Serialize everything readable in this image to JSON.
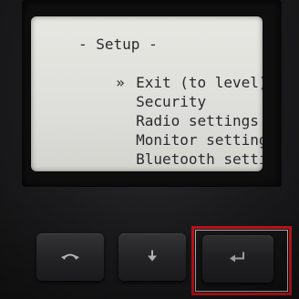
{
  "screen": {
    "title": "- Setup -",
    "selected_marker": "»",
    "items": [
      {
        "label": "Exit (to level)",
        "selected": true
      },
      {
        "label": "Security"
      },
      {
        "label": "Radio settings"
      },
      {
        "label": "Monitor settings"
      },
      {
        "label": "Bluetooth settings↓"
      }
    ]
  },
  "buttons": {
    "back_icon": "back-arrow-icon",
    "down_icon": "down-arrow-icon",
    "enter_icon": "enter-return-icon",
    "highlight_color": "#c8141a"
  }
}
